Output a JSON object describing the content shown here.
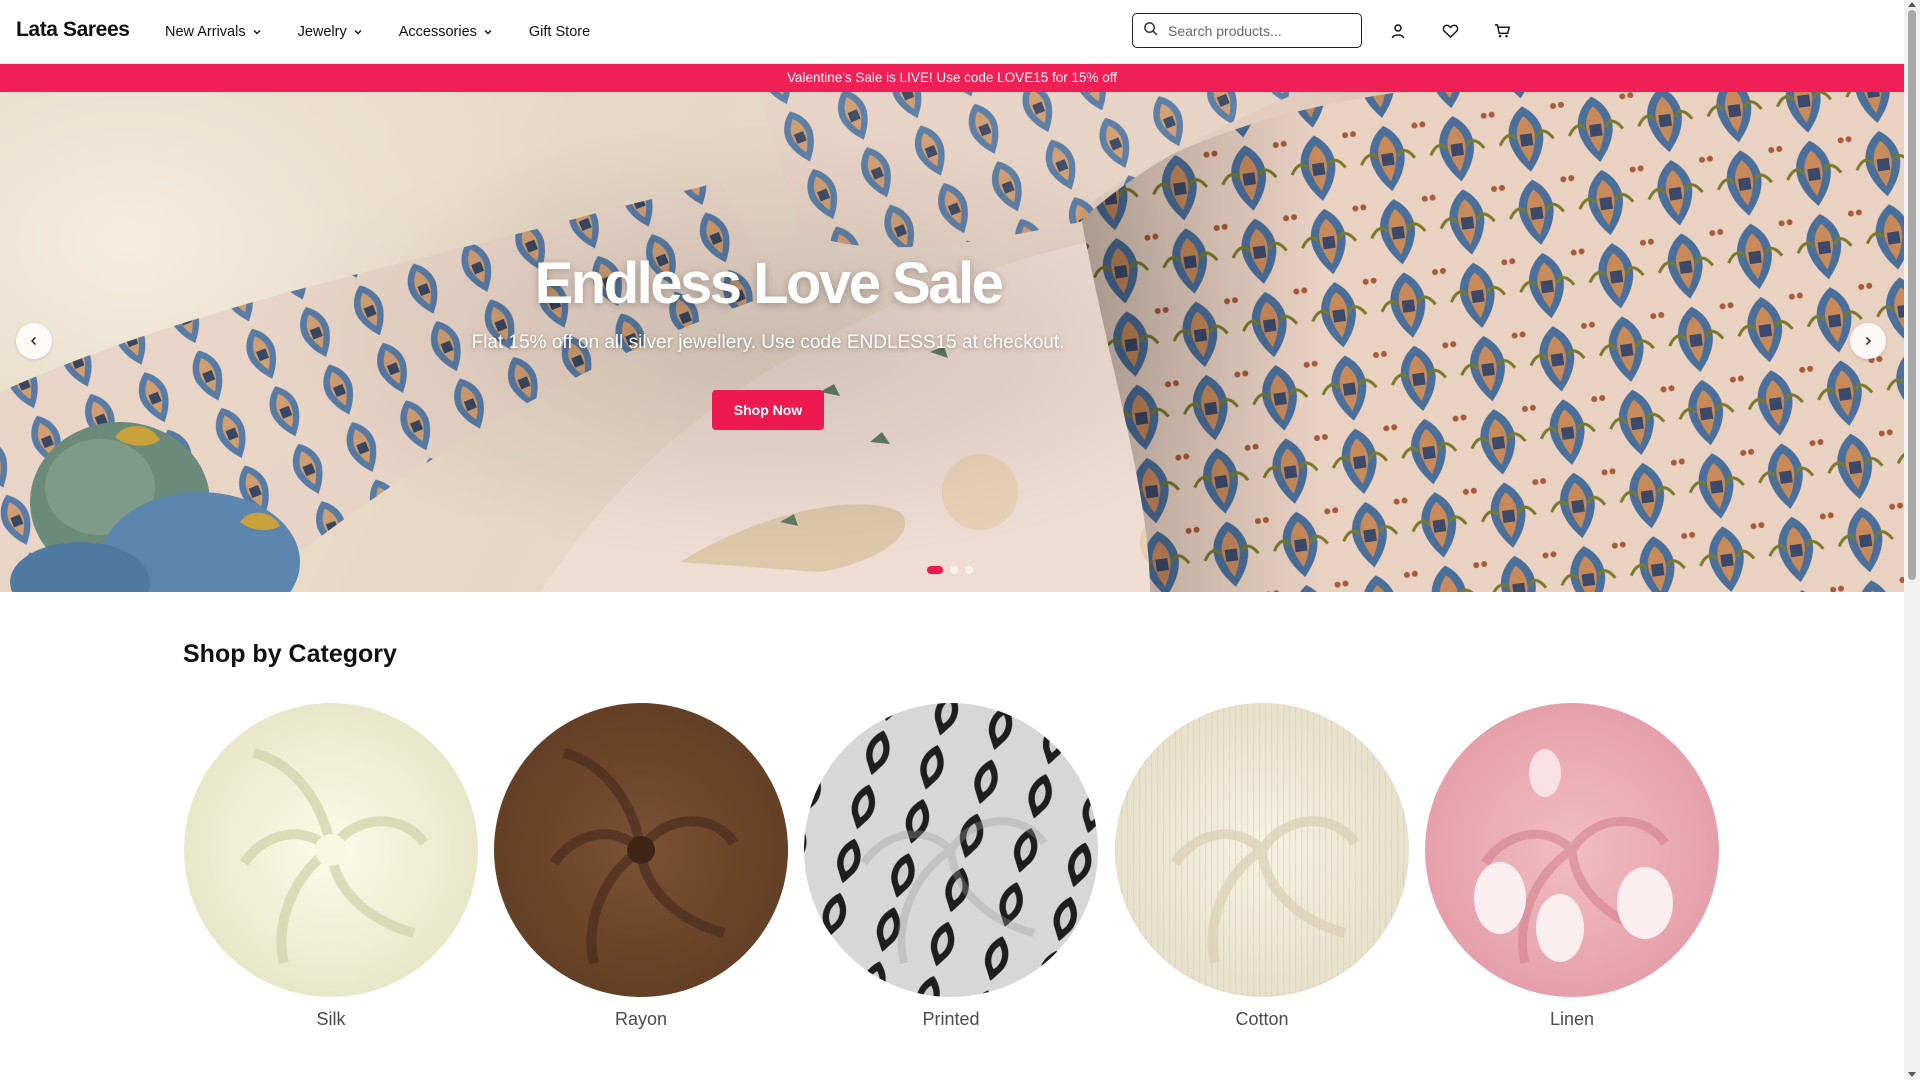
{
  "header": {
    "logo": "Lata Sarees",
    "nav": [
      {
        "label": "New Arrivals",
        "dropdown": true
      },
      {
        "label": "Jewelry",
        "dropdown": true
      },
      {
        "label": "Accessories",
        "dropdown": true
      },
      {
        "label": "Gift Store",
        "dropdown": false
      }
    ],
    "search": {
      "placeholder": "Search products...",
      "value": ""
    },
    "icons": [
      "user-icon",
      "heart-icon",
      "cart-icon"
    ]
  },
  "announcement": "Valentine's Sale is LIVE! Use code LOVE15 for 15% off",
  "hero": {
    "title": "Endless Love Sale",
    "subtitle": "Flat 15% off on all silver jewellery. Use code ENDLESS15 at checkout.",
    "button": "Shop Now",
    "slide_count": 3,
    "active_slide": 1
  },
  "categories_section": {
    "title": "Shop by Category",
    "items": [
      {
        "label": "Silk",
        "icon": "silk-fabric-image"
      },
      {
        "label": "Rayon",
        "icon": "rayon-fabric-image"
      },
      {
        "label": "Printed",
        "icon": "printed-fabric-image"
      },
      {
        "label": "Cotton",
        "icon": "cotton-fabric-image"
      },
      {
        "label": "Linen",
        "icon": "linen-fabric-image"
      }
    ]
  },
  "colors": {
    "accent": "#ec1a4f",
    "announcement_bg": "#f01f55"
  }
}
